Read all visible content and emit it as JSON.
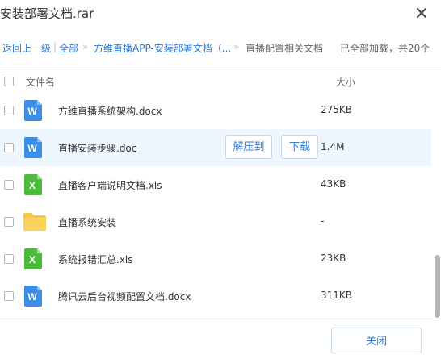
{
  "dialog": {
    "title": "安装部署文档.rar"
  },
  "breadcrumb": {
    "back": "返回上一级",
    "sep": "|",
    "all": "全部",
    "chevron": "»",
    "path1": "方维直播APP-安装部署文档（...",
    "current": "直播配置相关文档",
    "status": "已全部加载，共20个"
  },
  "columns": {
    "name": "文件名",
    "size": "大小"
  },
  "files": [
    {
      "name": "方维直播系统架构.docx",
      "size": "275KB",
      "icon": "word-doc-icon",
      "icon_letter": "W"
    },
    {
      "name": "直播安装步骤.doc",
      "size": "1.4M",
      "icon": "word-doc-icon",
      "icon_letter": "W"
    },
    {
      "name": "直播客户端说明文档.xls",
      "size": "43KB",
      "icon": "excel-doc-icon",
      "icon_letter": "X"
    },
    {
      "name": "直播系统安装",
      "size": "-",
      "icon": "folder-icon",
      "icon_letter": ""
    },
    {
      "name": "系统报错汇总.xls",
      "size": "23KB",
      "icon": "excel-doc-icon",
      "icon_letter": "X"
    },
    {
      "name": "腾讯云后台视频配置文档.docx",
      "size": "311KB",
      "icon": "word-doc-icon",
      "icon_letter": "W"
    }
  ],
  "row_actions": {
    "extract": "解压到",
    "download": "下载"
  },
  "footer": {
    "close": "关闭"
  },
  "colors": {
    "word": "#3b8fe8",
    "excel": "#4bbb3a",
    "folder": "#f7c744",
    "link": "#2f7bd3",
    "hover_row": "#eef6ff"
  }
}
